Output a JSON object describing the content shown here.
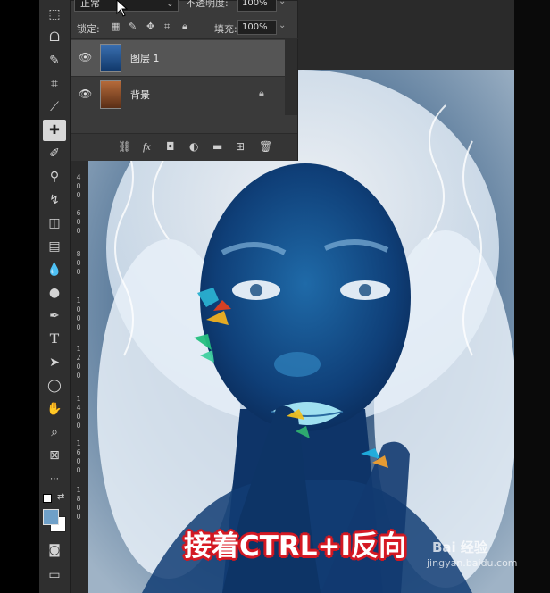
{
  "layers_panel": {
    "blend_mode": "正常",
    "opacity_label": "不透明度:",
    "opacity_value": "100%",
    "lock_label": "锁定:",
    "fill_label": "填充:",
    "fill_value": "100%",
    "layers": [
      {
        "name": "图层 1",
        "selected": true,
        "locked": false
      },
      {
        "name": "背景",
        "selected": false,
        "locked": true
      }
    ]
  },
  "ruler": {
    "labels": [
      "4",
      "0",
      "0",
      "6",
      "0",
      "0",
      "8",
      "0",
      "0",
      "1",
      "0",
      "0",
      "0",
      "1",
      "2",
      "0",
      "0",
      "1",
      "4",
      "0",
      "0",
      "1",
      "6",
      "0",
      "0",
      "1",
      "8",
      "0",
      "0"
    ]
  },
  "caption": "接着CTRL+I反向",
  "watermark": {
    "brand": "Bai 经验",
    "url": "jingyan.baidu.com"
  },
  "colors": {
    "caption_outline": "#d01822",
    "toolbar_bg": "#2f2f2f",
    "panel_bg": "#3a3a3a"
  }
}
